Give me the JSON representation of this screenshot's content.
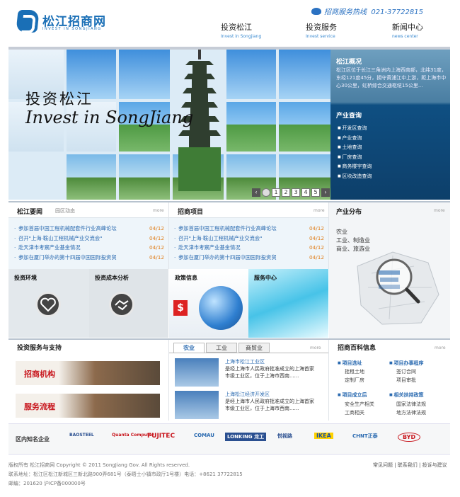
{
  "header": {
    "logo_cn": "松江招商网",
    "logo_en": "INVEST IN SONGJIANG",
    "hotline_label": "招商服务热线",
    "hotline_number": "021-37722815",
    "nav": [
      {
        "cn": "投资松江",
        "en": "Invest in Songjiang"
      },
      {
        "cn": "投资服务",
        "en": "Invest service"
      },
      {
        "cn": "新闻中心",
        "en": "news center"
      }
    ]
  },
  "banner": {
    "title_cn": "投资松江",
    "title_en": "Invest in SongJiang",
    "pager": [
      "1",
      "2",
      "3",
      "4",
      "5"
    ]
  },
  "overview": {
    "title": "松江概况",
    "desc": "松江区位于长江三角洲内上海西南部，北纬31度，东经121度45分，拥守黄浦江中上游，距上海市中心30公里，虹桥综合交通枢纽15公里...",
    "industry_title": "产业查询",
    "industry_items": [
      "开发区查询",
      "产业查询",
      "土地查询",
      "厂房查询",
      "商务楼宇查询",
      "区块改造查询"
    ]
  },
  "news": {
    "tab1": "松江要闻",
    "tab2": "园区动态",
    "more": "more",
    "items": [
      {
        "text": "参加首届中国工程机械配套件行业高峰论坛",
        "date": "04/12"
      },
      {
        "text": "召开\"上海·鞍山工程机械产业交流会\"",
        "date": "04/12"
      },
      {
        "text": "赴天津市考察产业基金情况",
        "date": "04/12"
      },
      {
        "text": "参加在厦门举办的第十四届中国国际投资贸",
        "date": "04/12"
      }
    ]
  },
  "projects": {
    "title": "招商项目",
    "more": "more",
    "items": [
      {
        "text": "参加首届中国工程机械配套件行业高峰论坛",
        "date": "04/12"
      },
      {
        "text": "召开\"上海·鞍山工程机械产业交流会\"",
        "date": "04/12"
      },
      {
        "text": "赴天津市考察产业基金情况",
        "date": "04/12"
      },
      {
        "text": "参加在厦门举办的第十四届中国国际投资贸",
        "date": "04/12"
      }
    ]
  },
  "distribution": {
    "title": "产业分布",
    "more": "more",
    "labels": [
      "农业",
      "工业、制造业",
      "商业、旅游业"
    ]
  },
  "tiles": [
    {
      "label": "投资环境"
    },
    {
      "label": "投资成本分析"
    },
    {
      "label": "政策信息"
    },
    {
      "label": "服务中心"
    }
  ],
  "support": {
    "title": "投资服务与支持",
    "cat1": "招商机构",
    "cat2": "服务流程"
  },
  "tabs": [
    "农业",
    "工业",
    "商贸业"
  ],
  "tab_more": "more",
  "zones": [
    {
      "title": "上海市松江工业区",
      "desc": "是经上海市人民政府批准成立的上海首家市级工业区，位于上海市西南......"
    },
    {
      "title": "上海松江经济开发区",
      "desc": "是经上海市人民政府批准成立的上海首家市级工业区，位于上海市西南......"
    }
  ],
  "encyclopedia": {
    "title": "招商百科信息",
    "more": "more",
    "groups": [
      {
        "head": "项目选址",
        "items": [
          "批租土地",
          "定制厂房"
        ]
      },
      {
        "head": "项目办事程序",
        "items": [
          "签订合同",
          "项目审批"
        ]
      },
      {
        "head": "项目成立后",
        "items": [
          "安全生产相关",
          "工商相关"
        ]
      },
      {
        "head": "相关扶持政策",
        "items": [
          "国家法律法规",
          "地方法律法规"
        ]
      }
    ]
  },
  "brands": {
    "label": "区内知名企业",
    "items": [
      "BAOSTEEL",
      "Quanta Computer",
      "FUJITEC",
      "COMAU",
      "LONKING 龙工",
      "悦视路",
      "IKEA",
      "CHNT正泰",
      "BYD"
    ]
  },
  "footer": {
    "line1": "版权所有 松江招商网 Copyright © 2011 SongJiang Gov. All Rights reserved.",
    "line2": "联系地址：松江区松江新城区三新北路900弄681号（泰晤士小镇市政厅1号楼）电话：+8621 37722815",
    "line3": "邮编：201620 沪ICP备000000号",
    "links": "常见问题 | 联系我们 | 投诉与建议"
  }
}
